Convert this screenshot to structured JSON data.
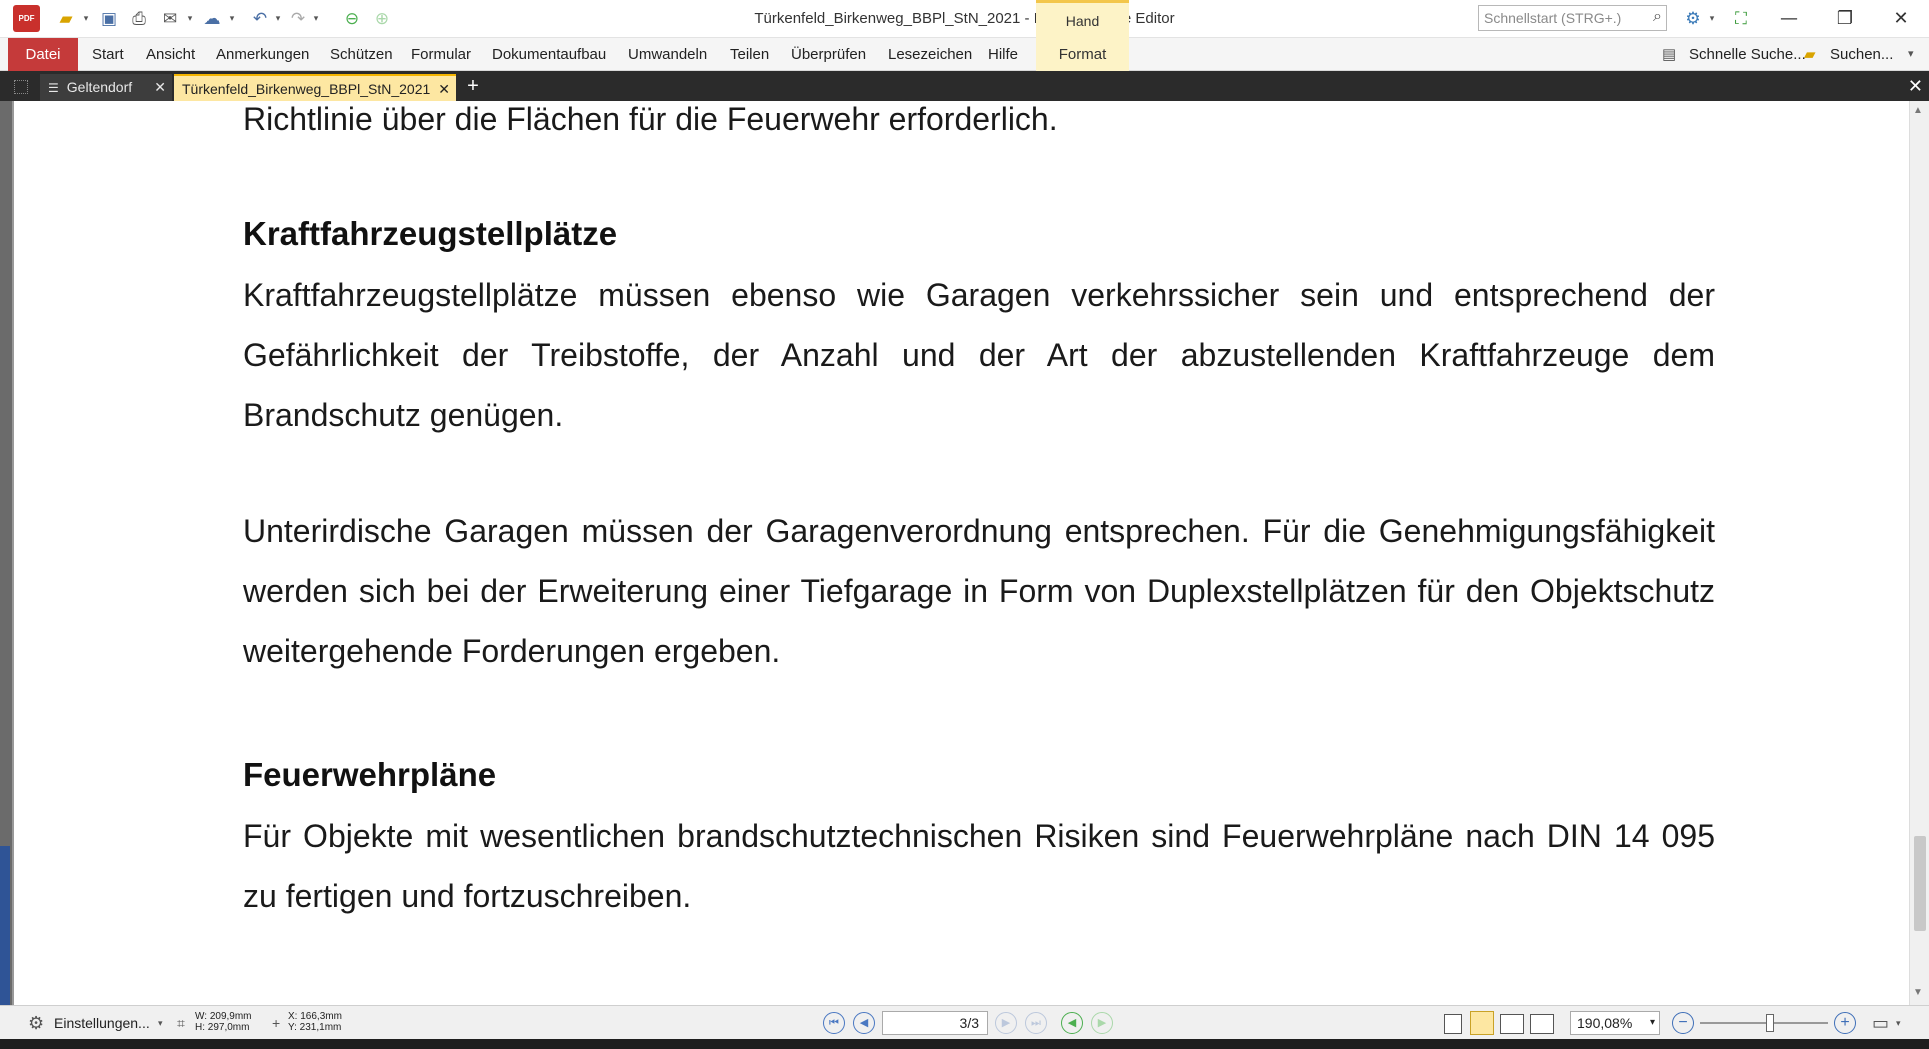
{
  "window": {
    "title": "Türkenfeld_Birkenweg_BBPl_StN_2021 - PDF-XChange Editor",
    "context_tab": "Hand",
    "quicklaunch_placeholder": "Schnellstart (STRG+.)",
    "logo_text": "PDF"
  },
  "menu": {
    "file": "Datei",
    "items": [
      "Start",
      "Ansicht",
      "Anmerkungen",
      "Schützen",
      "Formular",
      "Dokumentaufbau",
      "Umwandeln",
      "Teilen",
      "Überprüfen",
      "Lesezeichen",
      "Hilfe"
    ],
    "context_item": "Format",
    "quick_search": "Schnelle Suche...",
    "search": "Suchen..."
  },
  "tabs": {
    "inactive": "Geltendorf",
    "active": "Türkenfeld_Birkenweg_BBPl_StN_2021",
    "close_glyph": "✕",
    "add_glyph": "+"
  },
  "document": {
    "top_fragment": "Richtlinie über die Flächen für die Feuerwehr erforderlich.",
    "section1_heading": "Kraftfahrzeugstellplätze",
    "section1_para": "Kraftfahrzeugstellplätze müssen ebenso wie Garagen verkehrssicher sein und entsprechend der Gefährlichkeit der Treibstoffe, der Anzahl und der Art der abzustellenden Kraftfahrzeuge dem Brandschutz genügen.",
    "section1_para2": "Unterirdische Garagen müssen der Garagenverordnung entsprechen. Für die Genehmigungsfähigkeit werden sich bei der Erweiterung einer Tiefgarage in Form von Duplexstellplätzen für den Objektschutz weitergehende Forderungen ergeben.",
    "section2_heading": "Feuerwehrpläne",
    "section2_para": "Für Objekte mit wesentlichen brandschutztechnischen Risiken sind Feuerwehrpläne nach DIN 14 095 zu fertigen und fortzuschreiben."
  },
  "status": {
    "settings": "Einstellungen...",
    "width": "W: 209,9mm",
    "height": "H: 297,0mm",
    "x": "X: 166,3mm",
    "y": "Y: 231,1mm",
    "page": "3/3",
    "zoom": "190,08%"
  },
  "colors": {
    "accent_red": "#c53a3a",
    "context_yellow": "#fde7a2",
    "nav_blue": "#4a78c2"
  }
}
